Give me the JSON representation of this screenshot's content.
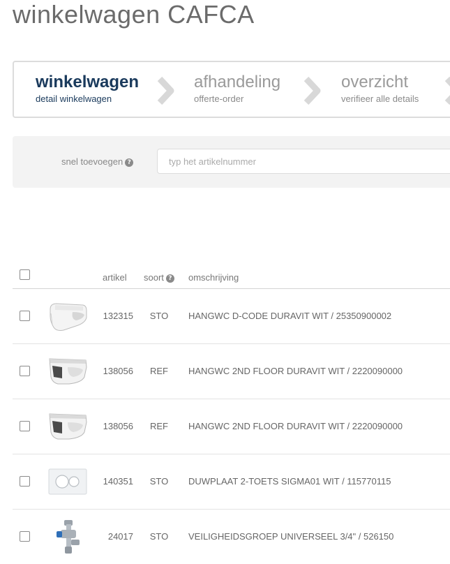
{
  "page": {
    "title": "winkelwagen CAFCA"
  },
  "steps": [
    {
      "title": "winkelwagen",
      "subtitle": "detail winkelwagen",
      "active": true
    },
    {
      "title": "afhandeling",
      "subtitle": "offerte-order",
      "active": false
    },
    {
      "title": "overzicht",
      "subtitle": "verifieer alle details",
      "active": false
    }
  ],
  "quick_add": {
    "label": "snel toevoegen",
    "placeholder": "typ het artikelnummer"
  },
  "table": {
    "headers": {
      "artikel": "artikel",
      "soort": "soort",
      "omschrijving": "omschrijving"
    },
    "rows": [
      {
        "artikel": "132315",
        "soort": "STO",
        "omschrijving": "HANGWC D-CODE DURAVIT WIT / 25350900002",
        "thumb": "toilet-dcode"
      },
      {
        "artikel": "138056",
        "soort": "REF",
        "omschrijving": "HANGWC 2ND FLOOR DURAVIT WIT / 2220090000",
        "thumb": "toilet-2ndfloor"
      },
      {
        "artikel": "138056",
        "soort": "REF",
        "omschrijving": "HANGWC 2ND FLOOR DURAVIT WIT / 2220090000",
        "thumb": "toilet-2ndfloor"
      },
      {
        "artikel": "140351",
        "soort": "STO",
        "omschrijving": "DUWPLAAT 2-TOETS SIGMA01 WIT / 115770115",
        "thumb": "flush-plate"
      },
      {
        "artikel": "24017",
        "soort": "STO",
        "omschrijving": "VEILIGHEIDSGROEP UNIVERSEEL 3/4\" / 526150",
        "thumb": "safety-valve"
      }
    ]
  },
  "colors": {
    "active_step": "#1a3a5c",
    "panel_bg": "#f3f3f3",
    "border": "#dcdcdc"
  }
}
